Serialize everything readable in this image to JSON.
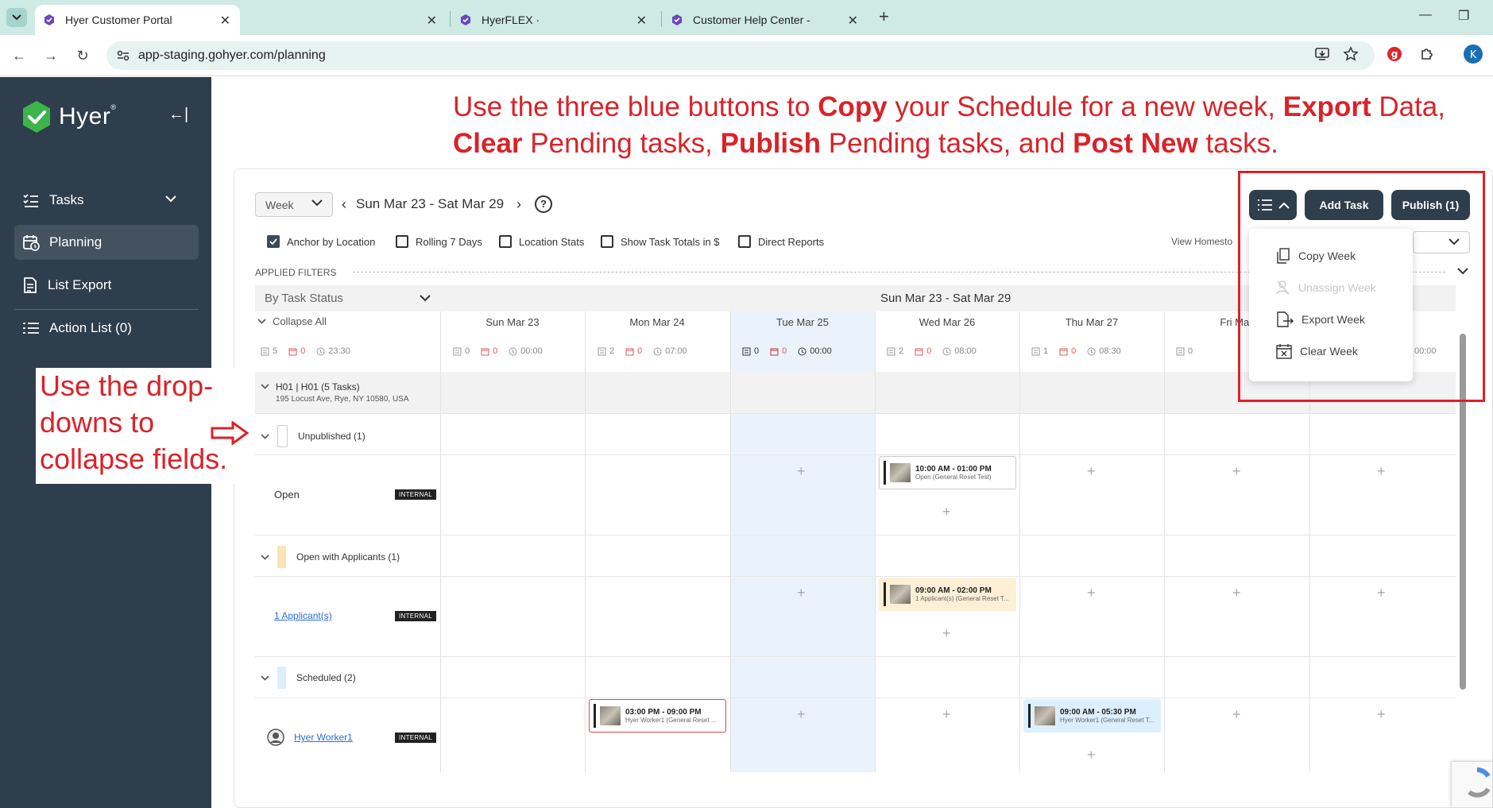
{
  "browser": {
    "tabs": [
      {
        "title": "Hyer Customer Portal",
        "active": true
      },
      {
        "title": "",
        "active": false
      },
      {
        "title": "HyerFLEX ·",
        "active": false
      },
      {
        "title": "Customer Help Center -",
        "active": false
      }
    ],
    "url": "app-staging.gohyer.com/planning",
    "profile_initial": "K",
    "extension_badge": "g"
  },
  "sidebar": {
    "logo_text": "Hyer",
    "items": [
      {
        "label": "Tasks",
        "icon": "tasks-icon"
      },
      {
        "label": "Planning",
        "icon": "calendar-clock-icon"
      },
      {
        "label": "List Export",
        "icon": "list-export-icon"
      },
      {
        "label": "Action List (0)",
        "icon": "action-list-icon"
      }
    ]
  },
  "annotations": {
    "header_parts": [
      {
        "text": "Use the three blue buttons to ",
        "bold": false
      },
      {
        "text": "Copy",
        "bold": true
      },
      {
        "text": " your Schedule for a new week, ",
        "bold": false
      },
      {
        "text": "Export",
        "bold": true
      },
      {
        "text": " Data, ",
        "bold": false
      },
      {
        "text": "Clear",
        "bold": true
      },
      {
        "text": " Pending tasks, ",
        "bold": false
      },
      {
        "text": "Publish",
        "bold": true
      },
      {
        "text": " Pending tasks, and ",
        "bold": false
      },
      {
        "text": "Post New",
        "bold": true
      },
      {
        "text": " tasks.",
        "bold": false
      }
    ],
    "left_note": "Use the drop-downs to collapse fields.",
    "accent_color": "#d8232a"
  },
  "toolbar": {
    "view_select": "Week",
    "date_range": "Sun Mar 23 - Sat Mar 29",
    "help_icon": "?",
    "add_task_label": "Add Task",
    "publish_label": "Publish (1)"
  },
  "options": [
    {
      "label": "Anchor by Location",
      "checked": true
    },
    {
      "label": "Rolling 7 Days",
      "checked": false
    },
    {
      "label": "Location Stats",
      "checked": false
    },
    {
      "label": "Show Task Totals in $",
      "checked": false
    },
    {
      "label": "Direct Reports",
      "checked": false
    }
  ],
  "view_homestore_label": "View Homesto",
  "applied_filters_label": "APPLIED FILTERS",
  "group_select": "By Task Status",
  "collapse_all": "Collapse All",
  "range_title": "Sun Mar 23 - Sat Mar 29",
  "summary_stats": {
    "tasks": "5",
    "alerts": "0",
    "hours": "23:30"
  },
  "days": [
    {
      "label": "Sun Mar 23",
      "tasks": "0",
      "alerts": "0",
      "hours": "00:00"
    },
    {
      "label": "Mon Mar 24",
      "tasks": "2",
      "alerts": "0",
      "hours": "07:00"
    },
    {
      "label": "Tue Mar 25",
      "tasks": "0",
      "alerts": "0",
      "hours": "00:00"
    },
    {
      "label": "Wed Mar 26",
      "tasks": "2",
      "alerts": "0",
      "hours": "08:00"
    },
    {
      "label": "Thu Mar 27",
      "tasks": "1",
      "alerts": "0",
      "hours": "08:30"
    },
    {
      "label": "Fri Mar",
      "tasks": "0",
      "alerts": "",
      "hours": ""
    },
    {
      "label": "",
      "tasks": "",
      "alerts": "",
      "hours": "00:00"
    }
  ],
  "location": {
    "name": "H01 | H01 (5 Tasks)",
    "address": "195 Locust Ave, Rye, NY 10580, USA"
  },
  "groups": {
    "unpublished": "Unpublished (1)",
    "open_label": "Open",
    "open_with_applicants": "Open with Applicants (1)",
    "applicants_link": "1 Applicant(s)",
    "scheduled": "Scheduled (2)",
    "worker_link": "Hyer Worker1",
    "badge": "INTERNAL"
  },
  "tasks": [
    {
      "time": "10:00 AM - 01:00 PM",
      "desc": "Open (General Reset Test)"
    },
    {
      "time": "09:00 AM - 02:00 PM",
      "desc": "1 Applicant(s) (General Reset T..."
    },
    {
      "time": "03:00 PM - 09:00 PM",
      "desc": "Hyer Worker1 (General Reset ..."
    },
    {
      "time": "09:00 AM - 05:30 PM",
      "desc": "Hyer Worker1 (General Reset T..."
    }
  ],
  "week_menu": [
    {
      "label": "Copy Week",
      "icon": "copy-icon",
      "disabled": false
    },
    {
      "label": "Unassign Week",
      "icon": "unassign-user-icon",
      "disabled": true
    },
    {
      "label": "Export Week",
      "icon": "export-icon",
      "disabled": false
    },
    {
      "label": "Clear Week",
      "icon": "clear-calendar-icon",
      "disabled": false
    }
  ]
}
